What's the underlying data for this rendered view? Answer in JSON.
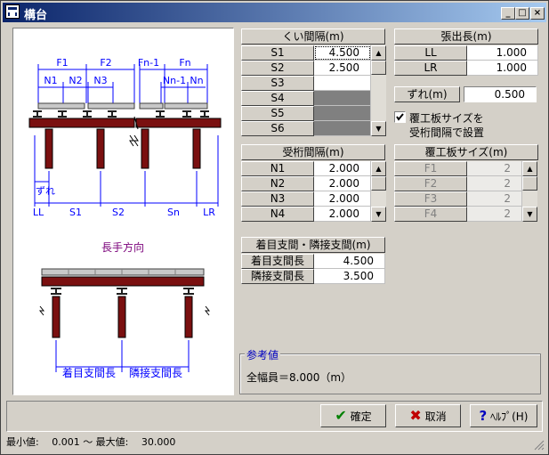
{
  "window": {
    "title": "構台"
  },
  "diagram": {
    "top_labels": [
      "F1",
      "F2",
      "Fn-1",
      "Fn",
      "N1",
      "N2",
      "N3",
      "Nn-1",
      "Nn"
    ],
    "bottom_labels": [
      "ずれ",
      "LL",
      "S1",
      "S2",
      "Sn",
      "LR"
    ],
    "direction_label": "長手方向",
    "bottom_span_labels": [
      "着目支間長",
      "隣接支間長"
    ]
  },
  "kui_spacing": {
    "header": "くい間隔(m)",
    "rows": [
      {
        "label": "S1",
        "value": "4.500"
      },
      {
        "label": "S2",
        "value": "2.500"
      },
      {
        "label": "S3",
        "value": ""
      },
      {
        "label": "S4",
        "value": ""
      },
      {
        "label": "S5",
        "value": ""
      },
      {
        "label": "S6",
        "value": ""
      }
    ]
  },
  "overhang": {
    "header": "張出長(m)",
    "rows": [
      {
        "label": "LL",
        "value": "1.000"
      },
      {
        "label": "LR",
        "value": "1.000"
      }
    ]
  },
  "offset": {
    "label": "ずれ(m)",
    "value": "0.500"
  },
  "checkbox": {
    "label_line1": "覆工板サイズを",
    "label_line2": "受桁間隔で設置",
    "checked": true
  },
  "girder_spacing": {
    "header": "受桁間隔(m)",
    "rows": [
      {
        "label": "N1",
        "value": "2.000"
      },
      {
        "label": "N2",
        "value": "2.000"
      },
      {
        "label": "N3",
        "value": "2.000"
      },
      {
        "label": "N4",
        "value": "2.000"
      }
    ]
  },
  "deck_size": {
    "header": "覆工板サイズ(m)",
    "rows": [
      {
        "label": "F1",
        "value": "2"
      },
      {
        "label": "F2",
        "value": "2"
      },
      {
        "label": "F3",
        "value": "2"
      },
      {
        "label": "F4",
        "value": "2"
      }
    ]
  },
  "span": {
    "header": "着目支間・隣接支間(m)",
    "rows": [
      {
        "label": "着目支間長",
        "value": "4.500"
      },
      {
        "label": "隣接支間長",
        "value": "3.500"
      }
    ]
  },
  "reference": {
    "title": "参考値",
    "text": "全幅員＝8.000（m）"
  },
  "buttons": {
    "ok": "確定",
    "cancel": "取消",
    "help": "ﾍﾙﾌﾟ(H)"
  },
  "status": {
    "text": "最小値:　 0.001 〜 最大値:　 30.000"
  },
  "colors": {
    "girder": "#7a1010",
    "dim_line": "#0000ff",
    "accent": "#0a246a"
  }
}
